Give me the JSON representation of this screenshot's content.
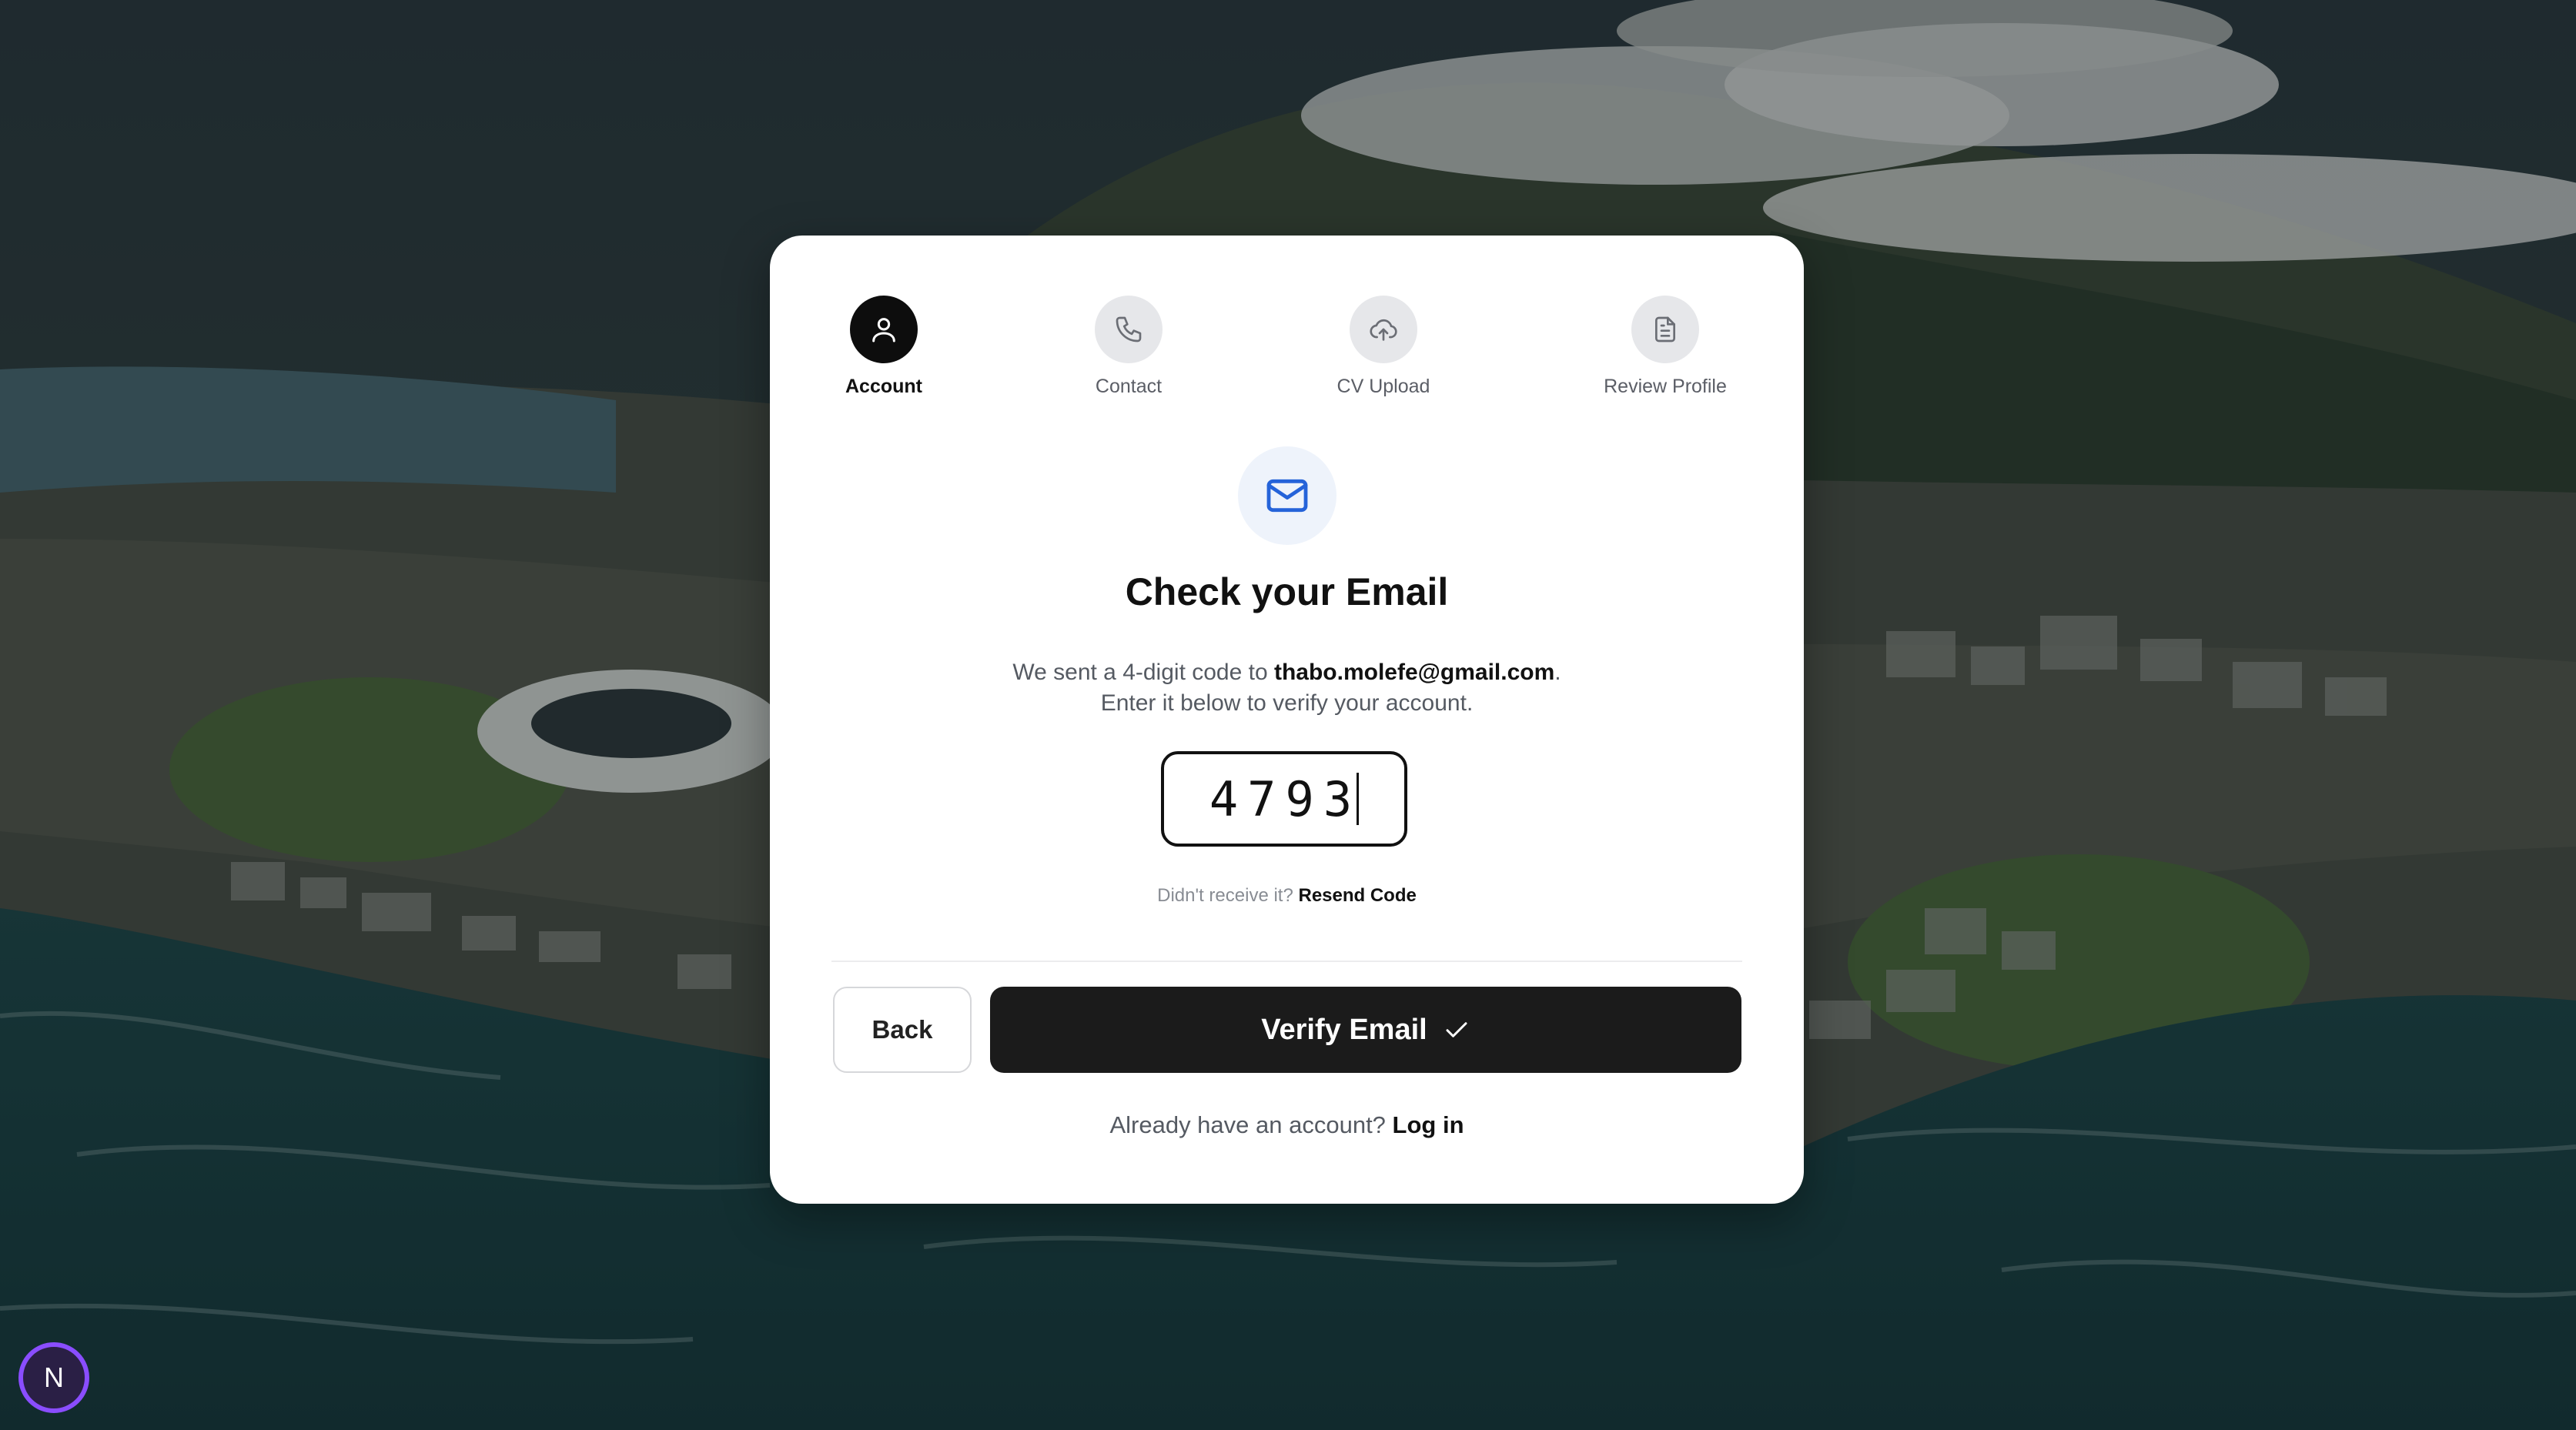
{
  "steps": [
    {
      "label": "Account",
      "icon": "user-icon",
      "active": true
    },
    {
      "label": "Contact",
      "icon": "phone-icon",
      "active": false
    },
    {
      "label": "CV Upload",
      "icon": "cloud-upload-icon",
      "active": false
    },
    {
      "label": "Review Profile",
      "icon": "document-icon",
      "active": false
    }
  ],
  "header": {
    "icon": "mail-icon",
    "title": "Check your Email"
  },
  "message": {
    "prefix": "We sent a 4-digit code to ",
    "email": "thabo.molefe@gmail.com",
    "suffix": ".",
    "line2": "Enter it below to verify your account."
  },
  "code_input": {
    "value": "4793"
  },
  "resend": {
    "prompt": "Didn't receive it?",
    "link": "Resend Code"
  },
  "actions": {
    "back_label": "Back",
    "verify_label": "Verify Email",
    "verify_icon": "check-icon"
  },
  "footer": {
    "prompt": "Already have an account?",
    "link": "Log in"
  },
  "badge": {
    "letter": "N"
  },
  "colors": {
    "primary": "#1b1b1b",
    "mail_icon": "#2563d9",
    "badge_ring": "#8a4dff"
  }
}
